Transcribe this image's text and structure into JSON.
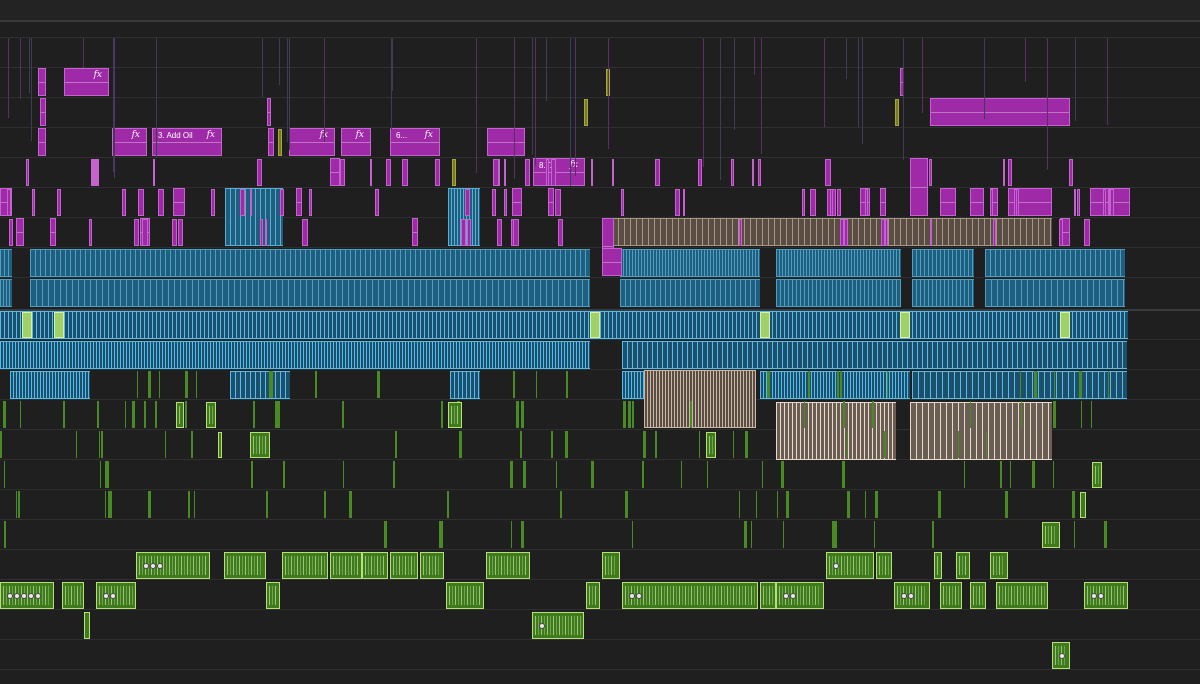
{
  "app": {
    "view": "timeline"
  },
  "colors": {
    "background": "#1f1f1f",
    "track_line": "#2f2f2f",
    "video_purple": "#9e2aa8",
    "video_teal": "#1e5f80",
    "video_light_blue": "#3aa3d8",
    "video_tan": "#77665a",
    "audio_green": "#3f7a1d",
    "audio_lime": "#9fd06a",
    "audio_tan": "#85776b"
  },
  "labelled_clips": [
    {
      "id": "clip-fx-1",
      "name": "",
      "fx": "fx"
    },
    {
      "id": "clip-fx-2",
      "name": "",
      "fx": "fx"
    },
    {
      "id": "clip-add-oil",
      "name": "3. Add Oil",
      "fx": "fx"
    },
    {
      "id": "clip-fx-3",
      "name": "",
      "fx": "fx"
    },
    {
      "id": "clip-fx-4",
      "name": "",
      "fx": "fx"
    },
    {
      "id": "clip-6",
      "name": "6...",
      "fx": "fx"
    },
    {
      "id": "clip-8",
      "name": "8.T...",
      "fx": "fx"
    }
  ],
  "icons": {
    "effect_badge": "fx-icon",
    "keyframe": "keyframe-dot-icon"
  }
}
